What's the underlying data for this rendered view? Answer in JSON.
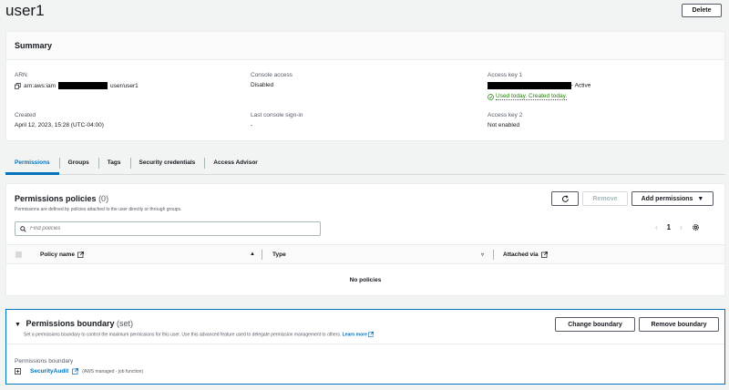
{
  "page": {
    "title": "user1",
    "delete_label": "Delete"
  },
  "summary": {
    "heading": "Summary",
    "arn": {
      "label": "ARN",
      "prefix": "arn:aws:iam",
      "suffix": "user/user1"
    },
    "console_access": {
      "label": "Console access",
      "value": "Disabled"
    },
    "access_key_1": {
      "label": "Access key 1",
      "status": "- Active",
      "usage": "Used today. Created today."
    },
    "created": {
      "label": "Created",
      "value": "April 12, 2023, 15:28 (UTC-04:00)"
    },
    "last_sign_in": {
      "label": "Last console sign-in",
      "value": "-"
    },
    "access_key_2": {
      "label": "Access key 2",
      "value": "Not enabled"
    }
  },
  "tabs": [
    {
      "label": "Permissions",
      "active": true
    },
    {
      "label": "Groups"
    },
    {
      "label": "Tags"
    },
    {
      "label": "Security credentials"
    },
    {
      "label": "Access Advisor"
    }
  ],
  "policies": {
    "title": "Permissions policies",
    "count": "(0)",
    "description": "Permissions are defined by policies attached to the user directly or through groups.",
    "remove_label": "Remove",
    "add_label": "Add permissions",
    "search_placeholder": "Find policies",
    "page": "1",
    "columns": {
      "name": "Policy name",
      "type": "Type",
      "attached": "Attached via"
    },
    "empty": "No policies"
  },
  "boundary": {
    "title": "Permissions boundary",
    "set": "(set)",
    "description": "Set a permissions boundary to control the maximum permissions for this user. Use this advanced feature used to delegate permission management to others.",
    "learn_more": "Learn more",
    "change_label": "Change boundary",
    "remove_label": "Remove boundary",
    "label": "Permissions boundary",
    "policy": "SecurityAudit",
    "policy_type": "(AWS managed - job function)"
  },
  "colors": {
    "link": "#0073bb",
    "success": "#1d8102",
    "text": "#16191f",
    "muted": "#545b64"
  }
}
